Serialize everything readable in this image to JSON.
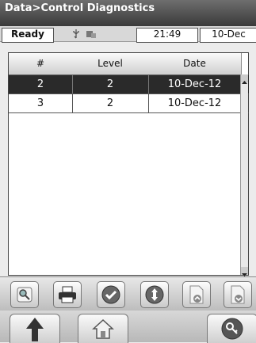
{
  "window": {
    "title": "Data>Control Diagnostics"
  },
  "status": {
    "state": "Ready",
    "time": "21:49",
    "date": "10-Dec"
  },
  "table": {
    "columns": [
      "#",
      "Level",
      "Date"
    ],
    "rows": [
      {
        "num": "2",
        "level": "2",
        "date": "10-Dec-12",
        "selected": true
      },
      {
        "num": "3",
        "level": "2",
        "date": "10-Dec-12",
        "selected": false
      }
    ]
  },
  "toolbar": {
    "icons": [
      "magnifier-icon",
      "printer-icon",
      "checkmark-icon",
      "scroll-updown-icon",
      "page-up-icon",
      "page-down-icon"
    ]
  },
  "nav": {
    "icons": [
      "up-arrow-icon",
      "home-icon",
      "key-icon"
    ]
  },
  "colors": {
    "title_bg": "#4a4a4a",
    "selected_row": "#2a2a2a",
    "check_blue": "#2f6fb0"
  }
}
